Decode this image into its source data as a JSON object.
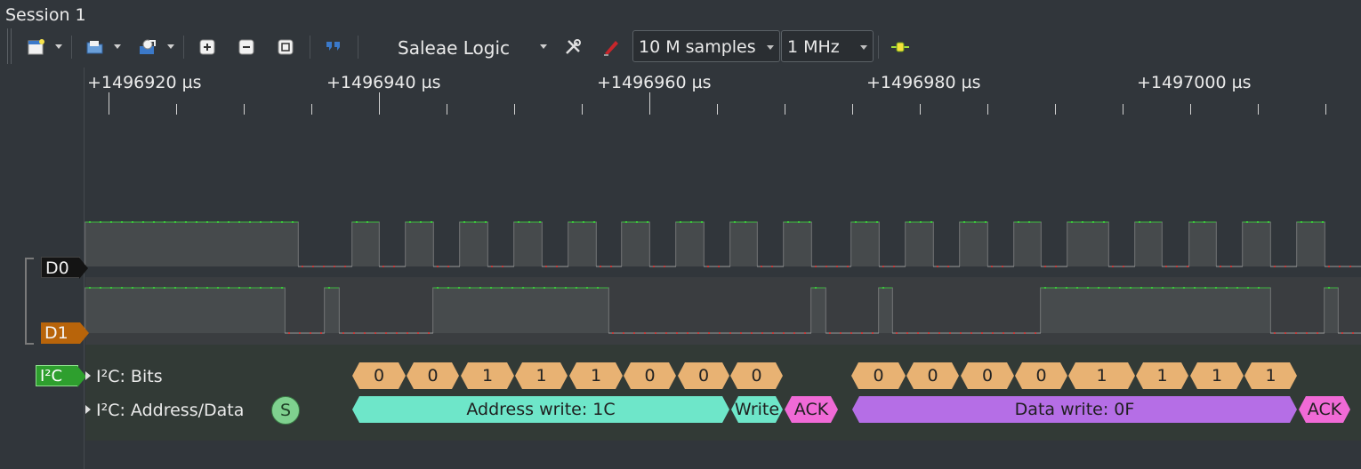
{
  "session": {
    "title": "Session 1"
  },
  "toolbar": {
    "device": "Saleae Logic",
    "samples": "10 M samples",
    "rate": "1 MHz"
  },
  "ruler": {
    "labels": [
      "+1496920 µs",
      "+1496940 µs",
      "+1496960 µs",
      "+1496980 µs",
      "+1497000 µs"
    ]
  },
  "channels": {
    "d0": "D0",
    "d1": "D1"
  },
  "analyzer": {
    "tag": "I²C",
    "bits_title": "I²C: Bits",
    "frames_title": "I²C: Address/Data",
    "start_marker": "S",
    "bits_group1": [
      "0",
      "0",
      "1",
      "1",
      "1",
      "0",
      "0",
      "0"
    ],
    "bits_group2": [
      "0",
      "0",
      "0",
      "0",
      "1",
      "1",
      "1",
      "1"
    ],
    "frames": {
      "address": "Address write: 1C",
      "write": "Write",
      "ack1": "ACK",
      "data": "Data write: 0F",
      "ack2": "ACK"
    }
  },
  "colors": {
    "high_dot": "#35d135",
    "low_dot": "#c83a3a",
    "bit_fill": "#e8b273",
    "address_fill": "#6ee6c9",
    "ack_fill": "#f06ad6",
    "data_fill": "#b56ee6"
  }
}
